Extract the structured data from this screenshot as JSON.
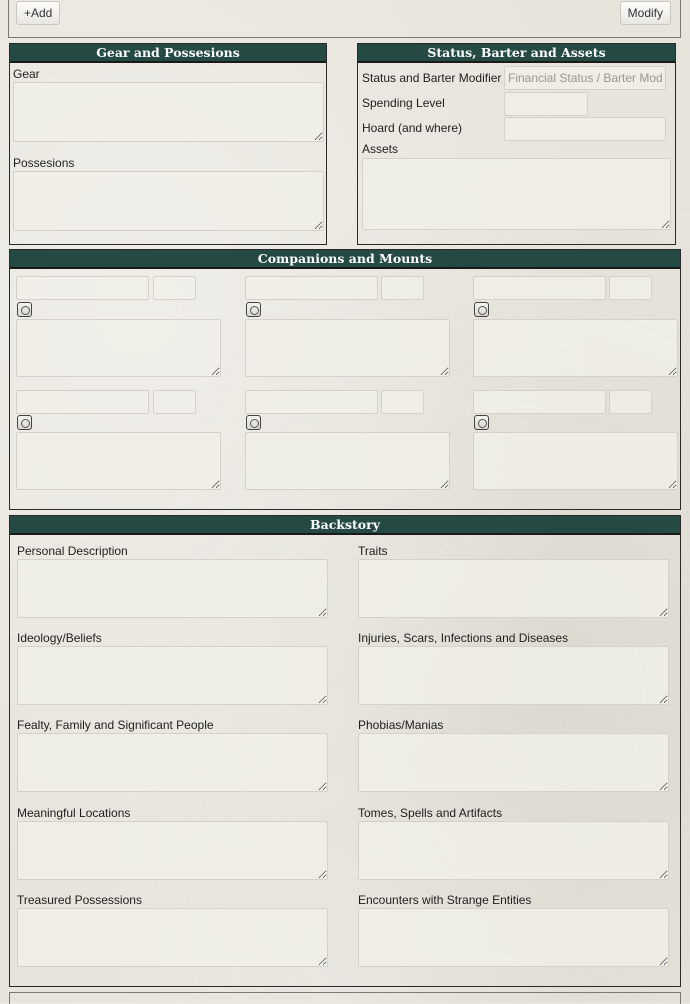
{
  "topbar": {
    "add_label": "+Add",
    "modify_label": "Modify"
  },
  "gear": {
    "title": "Gear and Possesions",
    "gear_label": "Gear",
    "possessions_label": "Possesions"
  },
  "status": {
    "title": "Status, Barter and Assets",
    "modifier_label": "Status and Barter Modifier",
    "modifier_placeholder": "Financial Status / Barter Modi",
    "spending_label": "Spending Level",
    "hoard_label": "Hoard (and where)",
    "assets_label": "Assets"
  },
  "companions": {
    "title": "Companions and Mounts",
    "slot_count": 6
  },
  "backstory": {
    "title": "Backstory",
    "left": [
      "Personal Description",
      "Ideology/Beliefs",
      "Fealty, Family and Significant People",
      "Meaningful Locations",
      "Treasured Possessions"
    ],
    "right": [
      "Traits",
      "Injuries, Scars, Infections and Diseases",
      "Phobias/Manias",
      "Tomes, Spells and Artifacts",
      "Encounters with Strange Entities"
    ]
  },
  "icons": {
    "companion_icon": "companion-portrait-icon"
  }
}
